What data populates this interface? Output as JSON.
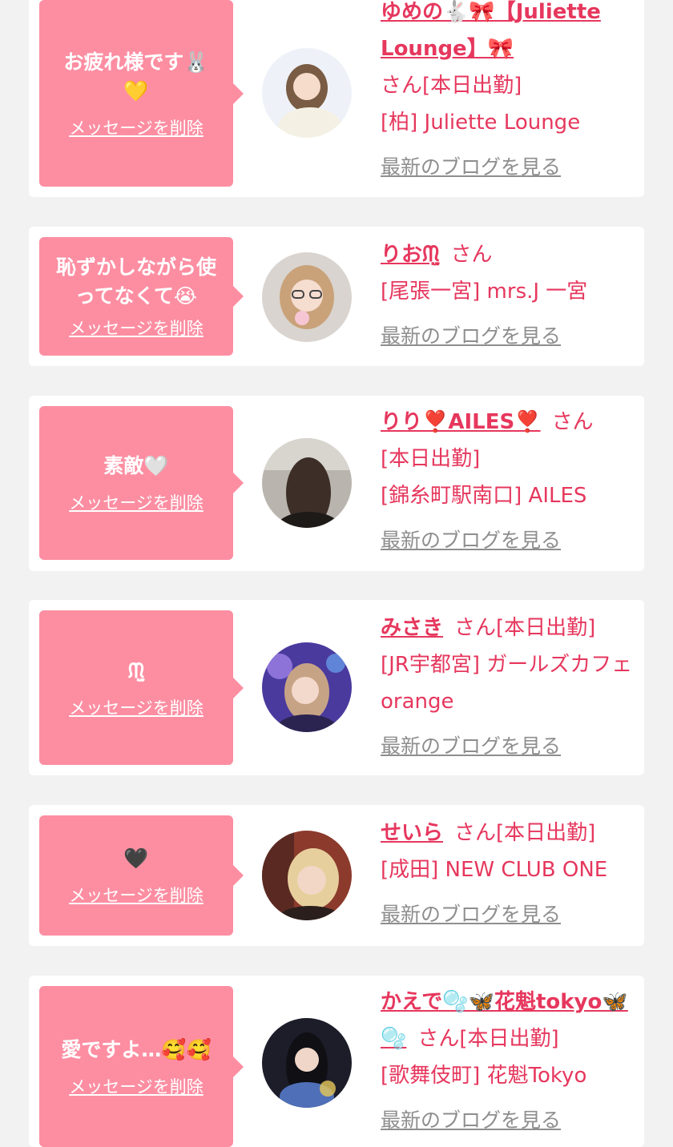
{
  "colors": {
    "accent": "#e6375d",
    "bubble": "#fd8ea2",
    "background": "#f2f2f2",
    "blog_link": "#8e8e8e"
  },
  "messages": [
    {
      "text": "お疲れ様です🐰\n💛",
      "delete_label": "メッセージを削除",
      "girl_name": "ゆめの🐇🎀【Juliette Lounge】🎀",
      "honorific": "さん",
      "working_badge": "[本日出勤]",
      "shop": "[柏] Juliette Lounge",
      "blog_label": "最新のブログを見る",
      "avatar": "avatar-photo-woman-white-top"
    },
    {
      "text": "恥ずかしながら使\nってなくて😭",
      "delete_label": "メッセージを削除",
      "girl_name": "りおᙏ̤̫",
      "honorific": "さん",
      "working_badge": "",
      "shop": "[尾張一宮] mrs.J 一宮",
      "blog_label": "最新のブログを見る",
      "avatar": "avatar-photo-woman-glasses"
    },
    {
      "text": "素敵🤍",
      "delete_label": "メッセージを削除",
      "girl_name": "りり❣️AILES❣️",
      "honorific": "さん",
      "working_badge": "[本日出勤]",
      "shop": "[錦糸町駅南口] AILES",
      "blog_label": "最新のブログを見る",
      "avatar": "avatar-photo-woman-back-view"
    },
    {
      "text": "ᙏ̤̫",
      "delete_label": "メッセージを削除",
      "girl_name": "みさき",
      "honorific": "さん",
      "working_badge": "[本日出勤]",
      "shop": "[JR宇都宮] ガールズカフェ orange",
      "blog_label": "最新のブログを見る",
      "avatar": "avatar-photo-woman-purple-light"
    },
    {
      "text": "🖤",
      "delete_label": "メッセージを削除",
      "girl_name": "せいら",
      "honorific": "さん",
      "working_badge": "[本日出勤]",
      "shop": "[成田] NEW CLUB ONE",
      "blog_label": "最新のブログを見る",
      "avatar": "avatar-photo-woman-blonde"
    },
    {
      "text": "愛ですよ…🥰🥰",
      "delete_label": "メッセージを削除",
      "girl_name": "かえで🫧🦋花魁tokyo🦋🫧",
      "honorific": "さん",
      "working_badge": "[本日出勤]",
      "shop": "[歌舞伎町] 花魁Tokyo",
      "blog_label": "最新のブログを見る",
      "avatar": "avatar-photo-woman-dark-hair"
    }
  ]
}
